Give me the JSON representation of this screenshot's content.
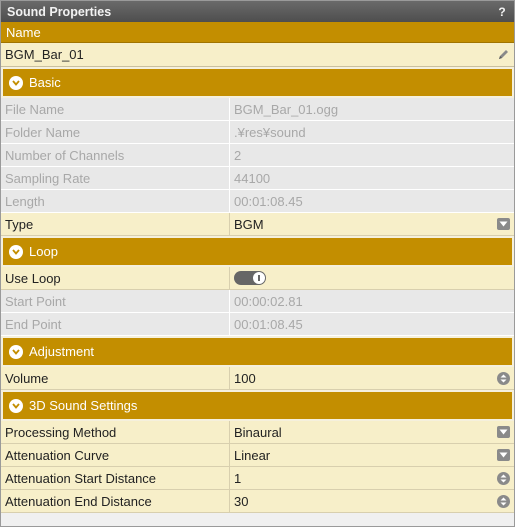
{
  "panel": {
    "title": "Sound Properties",
    "help": "?"
  },
  "name": {
    "header": "Name",
    "value": "BGM_Bar_01"
  },
  "basic": {
    "title": "Basic",
    "file_name": {
      "label": "File Name",
      "value": "BGM_Bar_01.ogg"
    },
    "folder_name": {
      "label": "Folder Name",
      "value": ".¥res¥sound"
    },
    "channels": {
      "label": "Number of Channels",
      "value": "2"
    },
    "sampling_rate": {
      "label": "Sampling Rate",
      "value": "44100"
    },
    "length": {
      "label": "Length",
      "value": "00:01:08.45"
    },
    "type": {
      "label": "Type",
      "value": "BGM"
    }
  },
  "loop": {
    "title": "Loop",
    "use_loop": {
      "label": "Use Loop",
      "enabled": true
    },
    "start_point": {
      "label": "Start Point",
      "value": "00:00:02.81"
    },
    "end_point": {
      "label": "End Point",
      "value": "00:01:08.45"
    }
  },
  "adjustment": {
    "title": "Adjustment",
    "volume": {
      "label": "Volume",
      "value": "100"
    }
  },
  "sound3d": {
    "title": "3D Sound Settings",
    "processing": {
      "label": "Processing Method",
      "value": "Binaural"
    },
    "curve": {
      "label": "Attenuation Curve",
      "value": "Linear"
    },
    "start_distance": {
      "label": "Attenuation Start Distance",
      "value": "1"
    },
    "end_distance": {
      "label": "Attenuation End Distance",
      "value": "30"
    }
  },
  "colors": {
    "accent": "#c38e00",
    "editable_bg": "#f7efc9",
    "readonly_bg": "#e8e8e8"
  }
}
